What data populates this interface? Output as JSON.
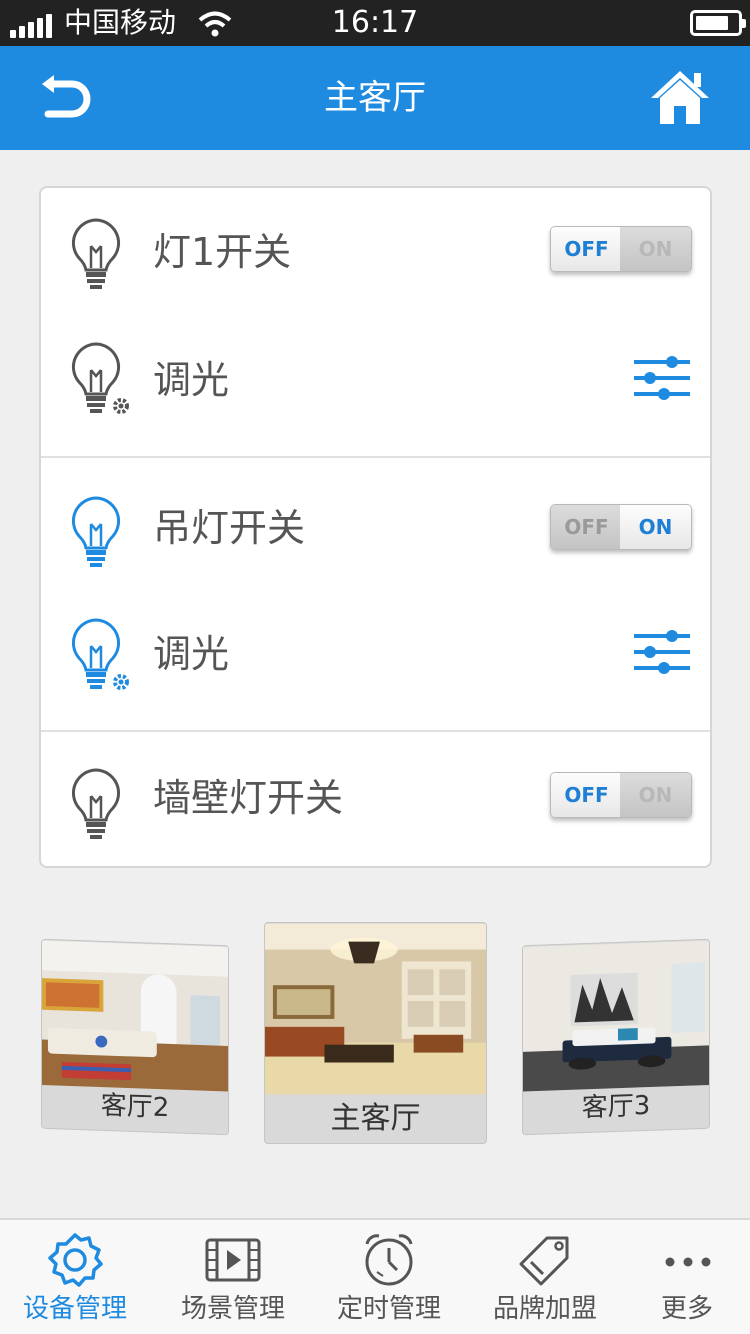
{
  "status_bar": {
    "carrier": "中国移动",
    "time": "16:17"
  },
  "nav": {
    "title": "主客厅"
  },
  "devices": {
    "light1_label": "灯1开关",
    "light1_toggle": {
      "off": "OFF",
      "on": "ON",
      "state": "off"
    },
    "dim1_label": "调光",
    "chandelier_label": "吊灯开关",
    "chandelier_toggle": {
      "off": "OFF",
      "on": "ON",
      "state": "on"
    },
    "dim2_label": "调光",
    "wall_label": "墙壁灯开关",
    "wall_toggle": {
      "off": "OFF",
      "on": "ON",
      "state": "off"
    }
  },
  "rooms": {
    "left": "客厅2",
    "center": "主客厅",
    "right": "客厅3"
  },
  "tabs": [
    {
      "label": "设备管理",
      "icon": "gear-icon",
      "active": true
    },
    {
      "label": "场景管理",
      "icon": "film-icon",
      "active": false
    },
    {
      "label": "定时管理",
      "icon": "alarm-clock-icon",
      "active": false
    },
    {
      "label": "品牌加盟",
      "icon": "tag-icon",
      "active": false
    },
    {
      "label": "更多",
      "icon": "more-icon",
      "active": false
    }
  ],
  "colors": {
    "accent": "#1f8be0",
    "inactive_icon": "#555555",
    "active_bulb": "#1f8be0"
  }
}
